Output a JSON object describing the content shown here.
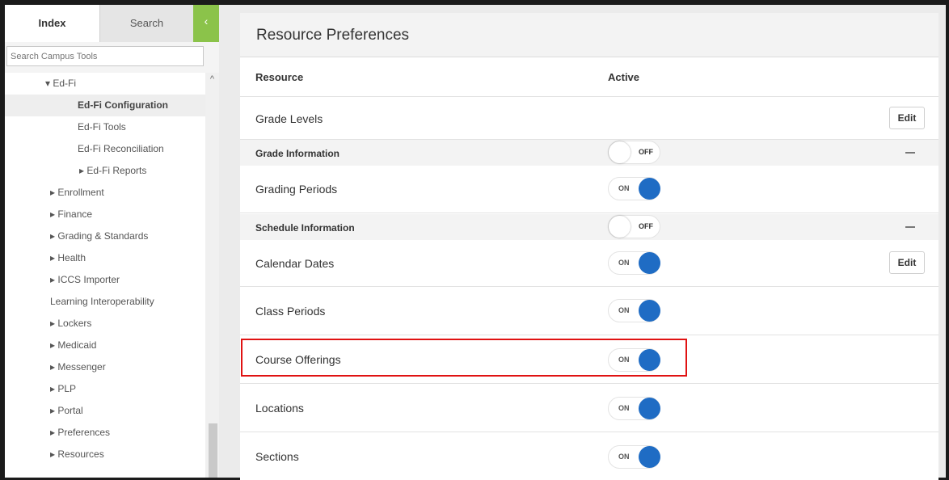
{
  "sidebar": {
    "tabs": {
      "index": "Index",
      "search": "Search"
    },
    "collapse_glyph": "‹",
    "search_placeholder": "Search Campus Tools",
    "items": [
      {
        "label": "▾ Ed-Fi"
      },
      {
        "label": "Ed-Fi Configuration",
        "selected": true
      },
      {
        "label": "Ed-Fi Tools"
      },
      {
        "label": "Ed-Fi Reconciliation"
      },
      {
        "label": "▸ Ed-Fi Reports"
      },
      {
        "label": "▸ Enrollment"
      },
      {
        "label": "▸ Finance"
      },
      {
        "label": "▸ Grading & Standards"
      },
      {
        "label": "▸ Health"
      },
      {
        "label": "▸ ICCS Importer"
      },
      {
        "label": "Learning Interoperability"
      },
      {
        "label": "▸ Lockers"
      },
      {
        "label": "▸ Medicaid"
      },
      {
        "label": "▸ Messenger"
      },
      {
        "label": "▸ PLP"
      },
      {
        "label": "▸ Portal"
      },
      {
        "label": "▸ Preferences"
      },
      {
        "label": "▸ Resources"
      }
    ],
    "scroll_up_glyph": "^"
  },
  "main": {
    "title": "Resource Preferences",
    "columns": {
      "resource": "Resource",
      "active": "Active"
    },
    "edit_label": "Edit",
    "toggle_on": "ON",
    "toggle_off": "OFF",
    "rows": {
      "grade_levels": "Grade Levels",
      "grade_information": "Grade Information",
      "grading_periods": "Grading Periods",
      "schedule_information": "Schedule Information",
      "calendar_dates": "Calendar Dates",
      "class_periods": "Class Periods",
      "course_offerings": "Course Offerings",
      "locations": "Locations",
      "sections": "Sections"
    }
  },
  "colors": {
    "accent_green": "#8bc34a",
    "toggle_on_blue": "#1f6cc4",
    "highlight_red": "#e01212"
  }
}
